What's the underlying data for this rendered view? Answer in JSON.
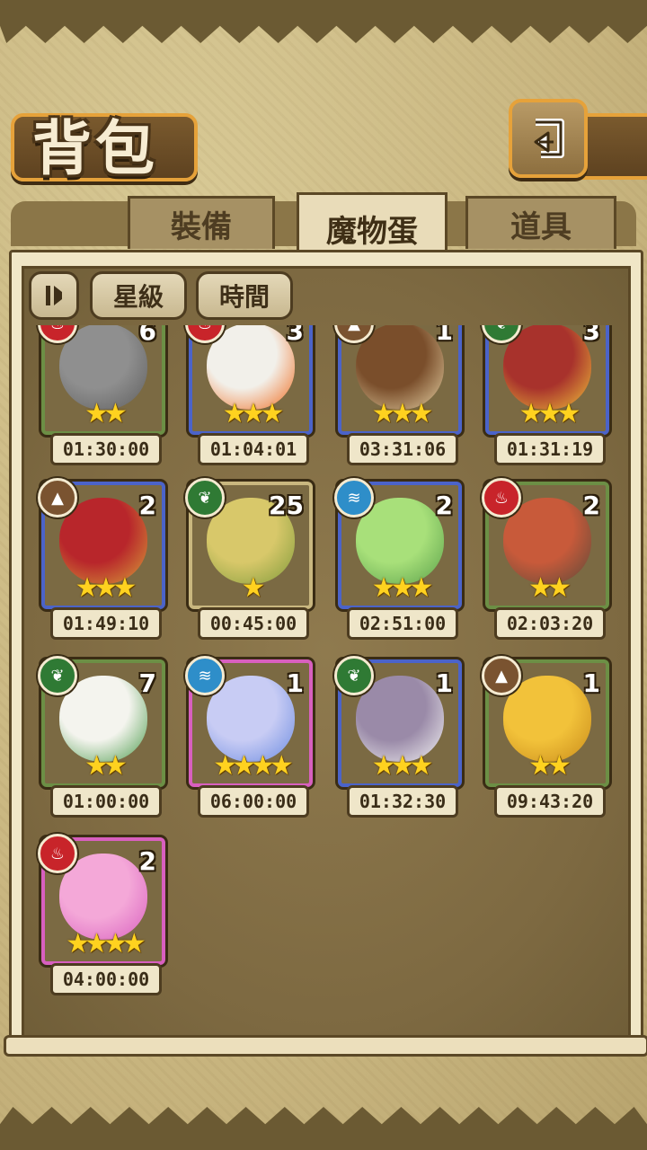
{
  "header": {
    "title": "背包"
  },
  "tabs": [
    {
      "label": "裝備",
      "active": false
    },
    {
      "label": "魔物蛋",
      "active": true
    },
    {
      "label": "道具",
      "active": false
    }
  ],
  "sort": {
    "toggle_icon": "pause-sort-icon",
    "star_label": "星級",
    "time_label": "時間"
  },
  "items": [
    {
      "element": "fire",
      "qty": "6",
      "stars": 2,
      "frame": "green",
      "timer": "01:30:00",
      "art": "stone-helmet-egg"
    },
    {
      "element": "fire",
      "qty": "3",
      "stars": 3,
      "frame": "blue",
      "timer": "01:04:01",
      "art": "flame-chicken-egg"
    },
    {
      "element": "earth",
      "qty": "1",
      "stars": 3,
      "frame": "blue",
      "timer": "03:31:06",
      "art": "monkey-egg"
    },
    {
      "element": "leaf",
      "qty": "3",
      "stars": 3,
      "frame": "blue",
      "timer": "01:31:19",
      "art": "spotted-mushroom-egg"
    },
    {
      "element": "earth",
      "qty": "2",
      "stars": 3,
      "frame": "blue",
      "timer": "01:49:10",
      "art": "spartan-helmet-egg"
    },
    {
      "element": "leaf",
      "qty": "25",
      "stars": 1,
      "frame": "tan",
      "timer": "00:45:00",
      "art": "leaf-egg"
    },
    {
      "element": "water",
      "qty": "2",
      "stars": 3,
      "frame": "blue",
      "timer": "02:51:00",
      "art": "green-slime-egg"
    },
    {
      "element": "fire",
      "qty": "2",
      "stars": 2,
      "frame": "green",
      "timer": "02:03:20",
      "art": "lava-egg"
    },
    {
      "element": "leaf",
      "qty": "7",
      "stars": 2,
      "frame": "green",
      "timer": "01:00:00",
      "art": "turnip-egg"
    },
    {
      "element": "water",
      "qty": "1",
      "stars": 4,
      "frame": "pink",
      "timer": "06:00:00",
      "art": "dragon-egg"
    },
    {
      "element": "leaf",
      "qty": "1",
      "stars": 3,
      "frame": "blue",
      "timer": "01:32:30",
      "art": "fluffy-egg"
    },
    {
      "element": "earth",
      "qty": "1",
      "stars": 2,
      "frame": "green",
      "timer": "09:43:20",
      "art": "gold-slime-egg"
    },
    {
      "element": "fire",
      "qty": "2",
      "stars": 4,
      "frame": "pink",
      "timer": "04:00:00",
      "art": "pink-blob-egg"
    }
  ],
  "colors": {
    "frame_green": "#6c8f45",
    "frame_blue": "#4b63c9",
    "frame_pink": "#d85fbf",
    "frame_tan": "#c9b77f",
    "element_fire": "#c8242a",
    "element_leaf": "#2f7a34",
    "element_water": "#2e8ec9",
    "element_earth": "#7a5330",
    "star": "#ffd21f"
  }
}
